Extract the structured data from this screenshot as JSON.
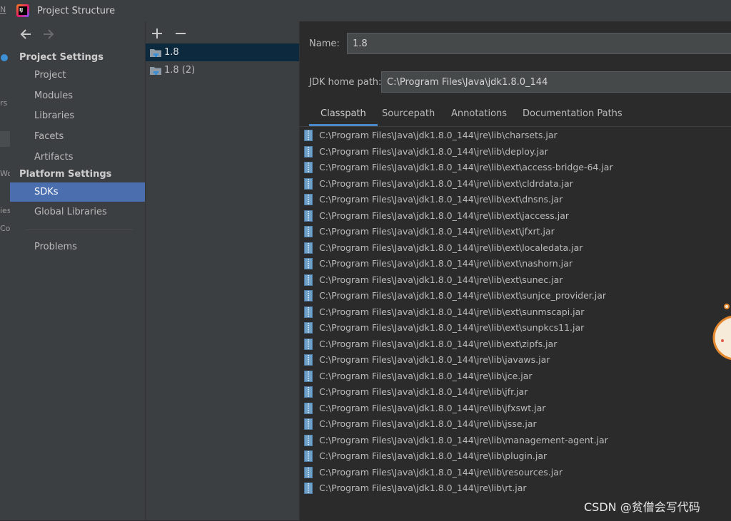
{
  "window": {
    "title": "Project Structure"
  },
  "nav": {
    "sections": [
      {
        "label": "Project Settings",
        "items": [
          "Project",
          "Modules",
          "Libraries",
          "Facets",
          "Artifacts"
        ]
      },
      {
        "label": "Platform Settings",
        "items": [
          "SDKs",
          "Global Libraries"
        ]
      }
    ],
    "problems": "Problems",
    "selected": "SDKs"
  },
  "sdk_list": {
    "items": [
      "1.8",
      "1.8 (2)"
    ],
    "selected": "1.8"
  },
  "details": {
    "name_label": "Name:",
    "name_value": "1.8",
    "home_label": "JDK home path:",
    "home_value": "C:\\Program Files\\Java\\jdk1.8.0_144",
    "tabs": [
      "Classpath",
      "Sourcepath",
      "Annotations",
      "Documentation Paths"
    ],
    "active_tab": "Classpath",
    "classpath": [
      "C:\\Program Files\\Java\\jdk1.8.0_144\\jre\\lib\\charsets.jar",
      "C:\\Program Files\\Java\\jdk1.8.0_144\\jre\\lib\\deploy.jar",
      "C:\\Program Files\\Java\\jdk1.8.0_144\\jre\\lib\\ext\\access-bridge-64.jar",
      "C:\\Program Files\\Java\\jdk1.8.0_144\\jre\\lib\\ext\\cldrdata.jar",
      "C:\\Program Files\\Java\\jdk1.8.0_144\\jre\\lib\\ext\\dnsns.jar",
      "C:\\Program Files\\Java\\jdk1.8.0_144\\jre\\lib\\ext\\jaccess.jar",
      "C:\\Program Files\\Java\\jdk1.8.0_144\\jre\\lib\\ext\\jfxrt.jar",
      "C:\\Program Files\\Java\\jdk1.8.0_144\\jre\\lib\\ext\\localedata.jar",
      "C:\\Program Files\\Java\\jdk1.8.0_144\\jre\\lib\\ext\\nashorn.jar",
      "C:\\Program Files\\Java\\jdk1.8.0_144\\jre\\lib\\ext\\sunec.jar",
      "C:\\Program Files\\Java\\jdk1.8.0_144\\jre\\lib\\ext\\sunjce_provider.jar",
      "C:\\Program Files\\Java\\jdk1.8.0_144\\jre\\lib\\ext\\sunmscapi.jar",
      "C:\\Program Files\\Java\\jdk1.8.0_144\\jre\\lib\\ext\\sunpkcs11.jar",
      "C:\\Program Files\\Java\\jdk1.8.0_144\\jre\\lib\\ext\\zipfs.jar",
      "C:\\Program Files\\Java\\jdk1.8.0_144\\jre\\lib\\javaws.jar",
      "C:\\Program Files\\Java\\jdk1.8.0_144\\jre\\lib\\jce.jar",
      "C:\\Program Files\\Java\\jdk1.8.0_144\\jre\\lib\\jfr.jar",
      "C:\\Program Files\\Java\\jdk1.8.0_144\\jre\\lib\\jfxswt.jar",
      "C:\\Program Files\\Java\\jdk1.8.0_144\\jre\\lib\\jsse.jar",
      "C:\\Program Files\\Java\\jdk1.8.0_144\\jre\\lib\\management-agent.jar",
      "C:\\Program Files\\Java\\jdk1.8.0_144\\jre\\lib\\plugin.jar",
      "C:\\Program Files\\Java\\jdk1.8.0_144\\jre\\lib\\resources.jar",
      "C:\\Program Files\\Java\\jdk1.8.0_144\\jre\\lib\\rt.jar"
    ]
  },
  "background": {
    "fragments": [
      "N",
      "rs",
      "Wo",
      "ies",
      "Co"
    ]
  },
  "watermark": "CSDN @贫僧会写代码",
  "icons": {
    "back": "arrow-left-icon",
    "forward": "arrow-right-icon",
    "add": "plus-icon",
    "remove": "minus-icon",
    "sdk": "jdk-folder-icon",
    "jar": "jar-file-icon"
  },
  "colors": {
    "selection": "#4b6eaf",
    "list_selection": "#0d293e",
    "tab_underline": "#4a88c7",
    "jar_icon": "#6d9fc7"
  }
}
